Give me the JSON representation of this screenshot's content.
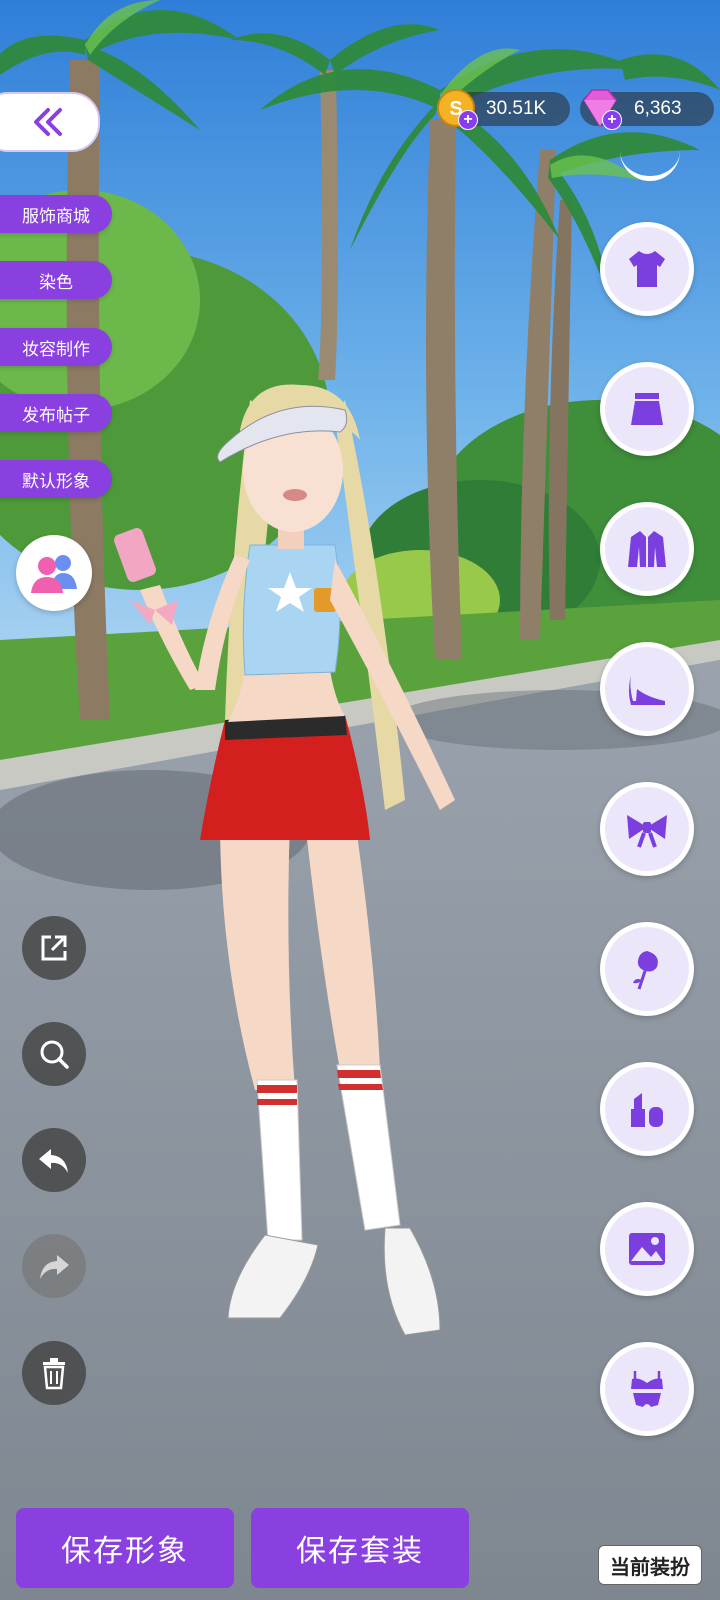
{
  "currency": {
    "coins": "30.51K",
    "gems": "6,363"
  },
  "side_menu": [
    {
      "label": "服饰商城",
      "name": "side-menu-shop"
    },
    {
      "label": "染色",
      "name": "side-menu-dye"
    },
    {
      "label": "妆容制作",
      "name": "side-menu-makeup"
    },
    {
      "label": "发布帖子",
      "name": "side-menu-post"
    },
    {
      "label": "默认形象",
      "name": "side-menu-default-look"
    }
  ],
  "categories": [
    "tops-icon",
    "skirt-icon",
    "jacket-icon",
    "shoes-icon",
    "bow-icon",
    "rose-icon",
    "makeup-icon",
    "background-icon",
    "lingerie-icon"
  ],
  "bottom": {
    "save_look": "保存形象",
    "save_outfit": "保存套装",
    "current_outfit": "当前装扮"
  },
  "colors": {
    "accent": "#8a3fe0",
    "icon_purple": "#7b3fe0"
  }
}
